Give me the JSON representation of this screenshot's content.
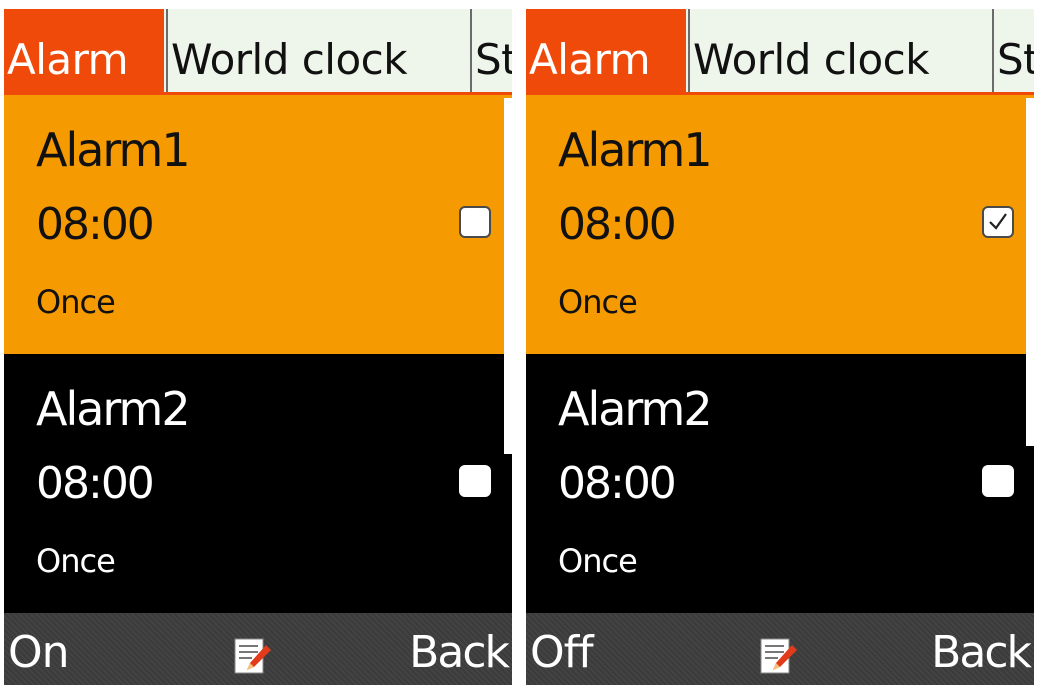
{
  "colors": {
    "tab_active_bg": "#f04a0a",
    "tab_inactive_bg": "#eef5ea",
    "selected_item_bg": "#f59a00",
    "normal_item_bg": "#000000",
    "softkey_bar_bg": "#3d3d3d"
  },
  "screens": [
    {
      "tabs": [
        {
          "label": "Alarm",
          "active": true
        },
        {
          "label": "World clock",
          "active": false
        },
        {
          "label": "St",
          "active": false
        }
      ],
      "alarms": [
        {
          "name": "Alarm1",
          "time": "08:00",
          "repeat": "Once",
          "enabled": false,
          "selected": true
        },
        {
          "name": "Alarm2",
          "time": "08:00",
          "repeat": "Once",
          "enabled": false,
          "selected": false
        }
      ],
      "softkeys": {
        "left": "On",
        "center_icon": "edit-icon",
        "right": "Back"
      }
    },
    {
      "tabs": [
        {
          "label": "Alarm",
          "active": true
        },
        {
          "label": "World clock",
          "active": false
        },
        {
          "label": "St",
          "active": false
        }
      ],
      "alarms": [
        {
          "name": "Alarm1",
          "time": "08:00",
          "repeat": "Once",
          "enabled": true,
          "selected": true
        },
        {
          "name": "Alarm2",
          "time": "08:00",
          "repeat": "Once",
          "enabled": false,
          "selected": false
        }
      ],
      "softkeys": {
        "left": "Off",
        "center_icon": "edit-icon",
        "right": "Back"
      }
    }
  ]
}
